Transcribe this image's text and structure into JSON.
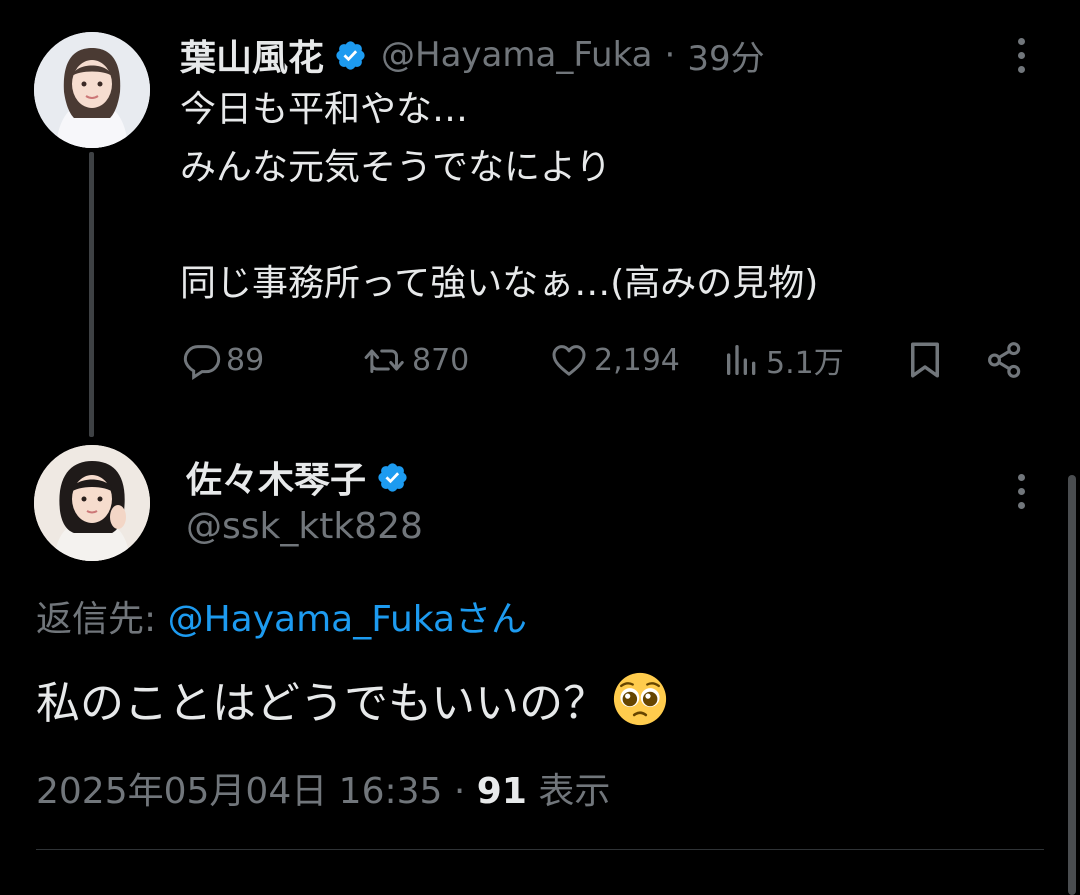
{
  "parent_tweet": {
    "author_name": "葉山風花",
    "author_handle": "@Hayama_Fuka",
    "separator": "·",
    "time_ago": "39分",
    "text_lines": [
      "今日も平和やな…",
      "みんな元気そうでなにより",
      "同じ事務所って強いなぁ…(高みの見物)"
    ],
    "stats": {
      "replies": "89",
      "retweets": "870",
      "likes": "2,194",
      "views": "5.1万"
    }
  },
  "reply_tweet": {
    "author_name": "佐々木琴子",
    "author_handle": "@ssk_ktk828",
    "reply_prefix": "返信先:",
    "reply_mention": "@Hayama_Fukaさん",
    "text": "私のことはどうでもいいの？",
    "emoji": "pleading-face",
    "timestamp": "2025年05月04日 16:35",
    "separator": "·",
    "views_count": "91",
    "views_label": "表示"
  },
  "colors": {
    "background": "#000000",
    "primary_text": "#e7e9ea",
    "secondary_text": "#71767b",
    "accent": "#1d9bf0",
    "thread_line": "#3e4144",
    "divider": "#2f3336"
  },
  "icons": [
    "verified-badge-icon",
    "more-icon",
    "reply-icon",
    "retweet-icon",
    "like-icon",
    "views-icon",
    "bookmark-icon",
    "share-icon"
  ]
}
